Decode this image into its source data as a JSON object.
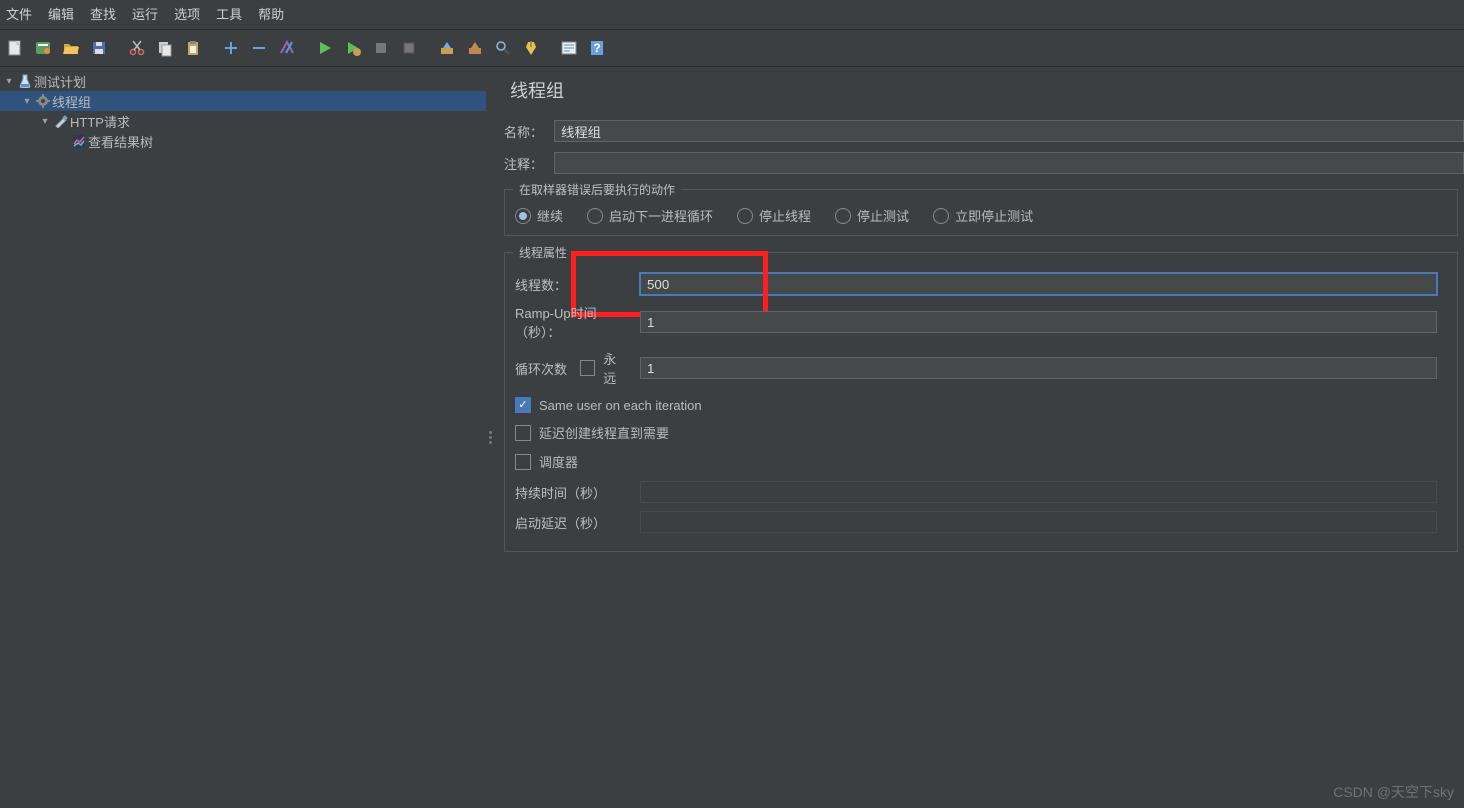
{
  "menubar": [
    "文件",
    "编辑",
    "查找",
    "运行",
    "选项",
    "工具",
    "帮助"
  ],
  "tree": {
    "plan": "测试计划",
    "threadGroup": "线程组",
    "httpRequest": "HTTP请求",
    "resultsTree": "查看结果树"
  },
  "panel": {
    "title": "线程组",
    "nameLabel": "名称：",
    "nameValue": "线程组",
    "commentLabel": "注释：",
    "commentValue": "",
    "errorGroup": {
      "legend": "在取样器错误后要执行的动作",
      "options": [
        "继续",
        "启动下一进程循环",
        "停止线程",
        "停止测试",
        "立即停止测试"
      ],
      "selected": 0
    },
    "threadGroup": {
      "legend": "线程属性",
      "threadsLabel": "线程数：",
      "threadsValue": "500",
      "rampLabel": "Ramp-Up时间（秒）：",
      "rampValue": "1",
      "loopLabel": "循环次数",
      "foreverLabel": "永远",
      "foreverChecked": false,
      "loopValue": "1",
      "sameUserLabel": "Same user on each iteration",
      "sameUserChecked": true,
      "delayCreateLabel": "延迟创建线程直到需要",
      "delayCreateChecked": false,
      "schedulerLabel": "调度器",
      "schedulerChecked": false,
      "durationLabel": "持续时间（秒）",
      "durationValue": "",
      "startupDelayLabel": "启动延迟（秒）",
      "startupDelayValue": ""
    }
  },
  "watermark": "CSDN @天空下sky"
}
